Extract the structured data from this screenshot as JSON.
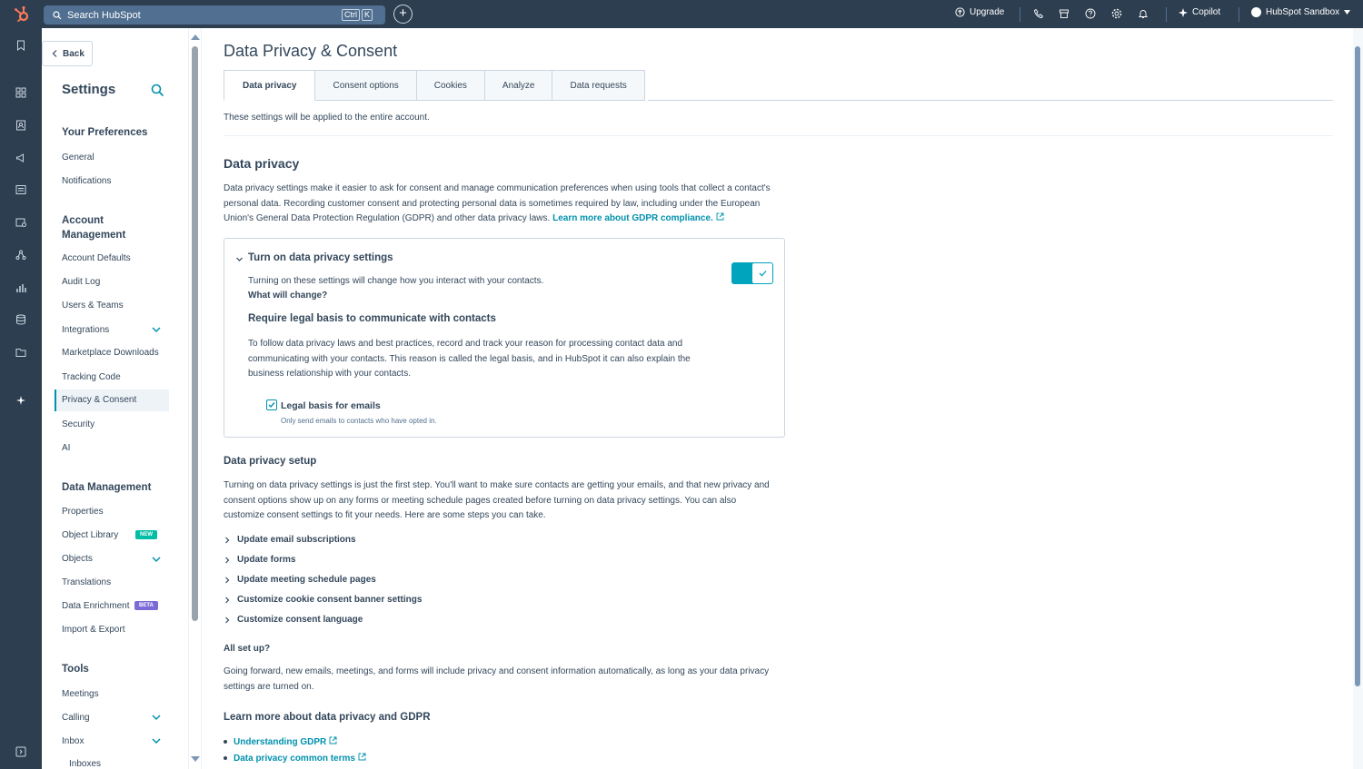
{
  "topbar": {
    "search_placeholder": "Search HubSpot",
    "shortcut_keys": [
      "Ctrl",
      "K"
    ],
    "upgrade_label": "Upgrade",
    "copilot_label": "Copilot",
    "account_label": "HubSpot Sandbox"
  },
  "sidebar": {
    "back_label": "Back",
    "title": "Settings",
    "sections": [
      {
        "heading": "Your Preferences",
        "items": [
          "General",
          "Notifications"
        ]
      },
      {
        "heading": "Account Management",
        "items": [
          "Account Defaults",
          "Audit Log",
          "Users & Teams",
          "Integrations",
          "Marketplace Downloads",
          "Tracking Code",
          "Privacy & Consent",
          "Security",
          "AI"
        ]
      },
      {
        "heading": "Data Management",
        "items": [
          "Properties",
          "Object Library",
          "Objects",
          "Translations",
          "Data Enrichment",
          "Import & Export"
        ]
      },
      {
        "heading": "Tools",
        "items": [
          "Meetings",
          "Calling",
          "Inbox",
          "Inboxes"
        ]
      }
    ],
    "badges": {
      "new": "NEW",
      "beta": "BETA"
    }
  },
  "main": {
    "page_title": "Data Privacy & Consent",
    "tabs": [
      "Data privacy",
      "Consent options",
      "Cookies",
      "Analyze",
      "Data requests"
    ],
    "account_note": "These settings will be applied to the entire account.",
    "section_title": "Data privacy",
    "intro": "Data privacy settings make it easier to ask for consent and manage communication preferences when using tools that collect a contact's personal data. Recording customer consent and protecting personal data is sometimes required by law, including under the European Union's General Data Protection Regulation (GDPR) and other data privacy laws.",
    "intro_link": "Learn more about GDPR compliance.",
    "card": {
      "title": "Turn on data privacy settings",
      "text": "Turning on these settings will change how you interact with your contacts.",
      "what_link": "What will change?",
      "sub_title": "Require legal basis to communicate with contacts",
      "sub_text": "To follow data privacy laws and best practices, record and track your reason for processing contact data and communicating with your contacts. This reason is called the legal basis, and in HubSpot it can also explain the business relationship with your contacts.",
      "checkbox_label": "Legal basis for emails",
      "checkbox_help": "Only send emails to contacts who have opted in.",
      "toggle_on": true
    },
    "setup_title": "Data privacy setup",
    "setup_text": "Turning on data privacy settings is just the first step. You'll want to make sure contacts are getting your emails, and that new privacy and consent options show up on any forms or meeting schedule pages created before turning on data privacy settings. You can also customize consent settings to fit your needs. Here are some steps you can take.",
    "setup_items": [
      "Update email subscriptions",
      "Update forms",
      "Update meeting schedule pages",
      "Customize cookie consent banner settings",
      "Customize consent language"
    ],
    "all_set_title": "All set up?",
    "all_set_text": "Going forward, new emails, meetings, and forms will include privacy and consent information automatically, as long as your data privacy settings are turned on.",
    "learn_title": "Learn more about data privacy and GDPR",
    "learn_links": [
      "Understanding GDPR",
      "Data privacy common terms"
    ]
  },
  "colors": {
    "topbar": "#2d3e50",
    "accent": "#0091ae",
    "toggle": "#00a4bd",
    "new_badge": "#00bda5",
    "beta_badge": "#7c6bd6"
  }
}
